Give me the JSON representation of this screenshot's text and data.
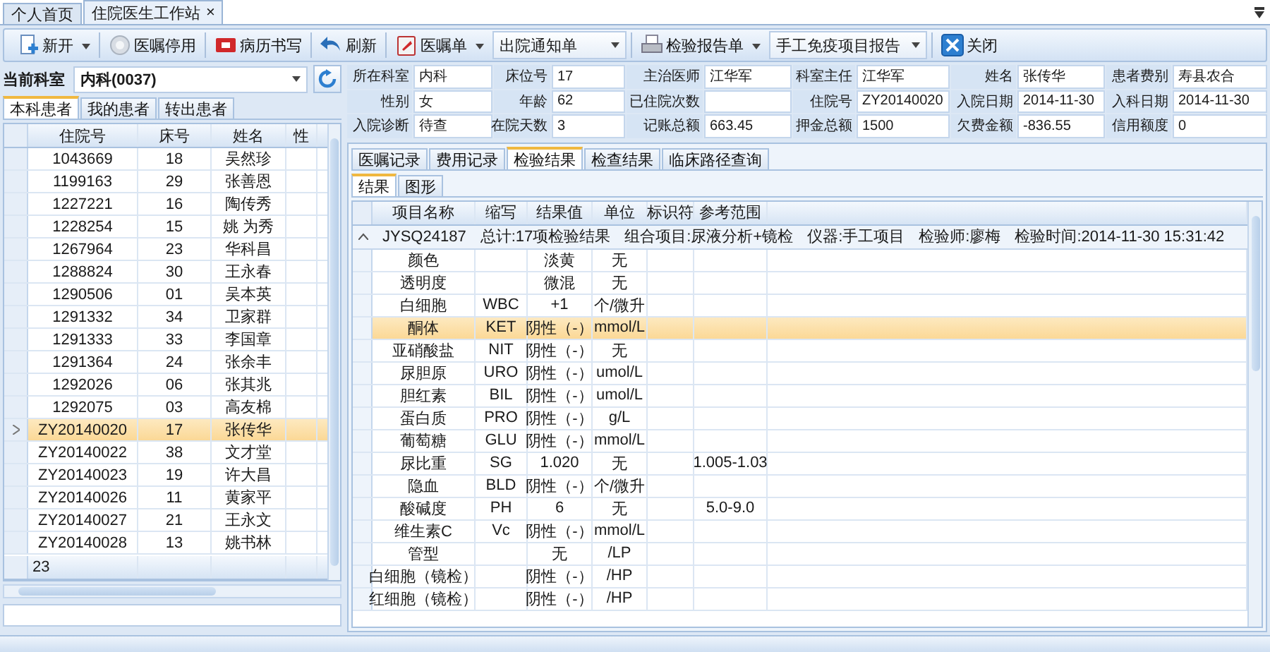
{
  "doc_tabs": [
    {
      "label": "个人首页",
      "selected": false
    },
    {
      "label": "住院医生工作站",
      "selected": true,
      "close": "×"
    }
  ],
  "toolbar": [
    {
      "kind": "button",
      "label": "新开",
      "dropdown": true
    },
    {
      "kind": "button",
      "label": "医嘱停用",
      "dropdown": false
    },
    {
      "kind": "button",
      "label": "病历书写",
      "dropdown": false
    },
    {
      "kind": "button",
      "label": "刷新",
      "dropdown": false
    },
    {
      "kind": "button",
      "label": "医嘱单",
      "dropdown": true
    },
    {
      "kind": "select",
      "value": "出院通知单"
    },
    {
      "kind": "button",
      "label": "检验报告单",
      "dropdown": true
    },
    {
      "kind": "select",
      "value": "手工免疫项目报告"
    },
    {
      "kind": "button",
      "label": "关闭",
      "dropdown": false
    }
  ],
  "department": {
    "label": "当前科室",
    "value": "内科(0037)"
  },
  "patient_tabs": [
    {
      "label": "本科患者",
      "selected": true
    },
    {
      "label": "我的患者",
      "selected": false
    },
    {
      "label": "转出患者",
      "selected": false
    }
  ],
  "patient_grid": {
    "columns": [
      "住院号",
      "床号",
      "姓名",
      "性"
    ],
    "rows": [
      {
        "id": "1043669",
        "bed": "18",
        "name": "吴然珍",
        "selected": false
      },
      {
        "id": "1199163",
        "bed": "29",
        "name": "张善恩",
        "selected": false
      },
      {
        "id": "1227221",
        "bed": "16",
        "name": "陶传秀",
        "selected": false
      },
      {
        "id": "1228254",
        "bed": "15",
        "name": "姚 为秀",
        "selected": false
      },
      {
        "id": "1267964",
        "bed": "23",
        "name": "华科昌",
        "selected": false
      },
      {
        "id": "1288824",
        "bed": "30",
        "name": "王永春",
        "selected": false
      },
      {
        "id": "1290506",
        "bed": "01",
        "name": "吴本英",
        "selected": false
      },
      {
        "id": "1291332",
        "bed": "34",
        "name": "卫家群",
        "selected": false
      },
      {
        "id": "1291333",
        "bed": "33",
        "name": "李国章",
        "selected": false
      },
      {
        "id": "1291364",
        "bed": "24",
        "name": "张余丰",
        "selected": false
      },
      {
        "id": "1292026",
        "bed": "06",
        "name": "张其兆",
        "selected": false
      },
      {
        "id": "1292075",
        "bed": "03",
        "name": "高友棉",
        "selected": false
      },
      {
        "id": "ZY20140020",
        "bed": "17",
        "name": "张传华",
        "selected": true
      },
      {
        "id": "ZY20140022",
        "bed": "38",
        "name": "文才堂",
        "selected": false
      },
      {
        "id": "ZY20140023",
        "bed": "19",
        "name": "许大昌",
        "selected": false
      },
      {
        "id": "ZY20140026",
        "bed": "11",
        "name": "黄家平",
        "selected": false
      },
      {
        "id": "ZY20140027",
        "bed": "21",
        "name": "王永文",
        "selected": false
      },
      {
        "id": "ZY20140028",
        "bed": "13",
        "name": "姚书林",
        "selected": false
      }
    ],
    "footer": "23"
  },
  "patient_info": [
    [
      {
        "label": "所在科室",
        "value": "内科"
      },
      {
        "label": "床位号",
        "value": "17"
      },
      {
        "label": "主治医师",
        "value": "江华军"
      },
      {
        "label": "科室主任",
        "value": "江华军"
      },
      {
        "label": "姓名",
        "value": "张传华"
      },
      {
        "label": "患者费别",
        "value": "寿县农合"
      }
    ],
    [
      {
        "label": "性别",
        "value": "女"
      },
      {
        "label": "年龄",
        "value": "62"
      },
      {
        "label": "已住院次数"
      },
      {
        "label": "住院号",
        "value": "ZY20140020"
      },
      {
        "label": "入院日期",
        "value": "2014-11-30"
      },
      {
        "label": "入科日期",
        "value": "2014-11-30"
      }
    ],
    [
      {
        "label": "入院诊断",
        "value": "待查"
      },
      {
        "label": "在院天数",
        "value": "3"
      },
      {
        "label": "记账总额",
        "value": "663.45"
      },
      {
        "label": "押金总额",
        "value": "1500"
      },
      {
        "label": "欠费金额",
        "value": "-836.55"
      },
      {
        "label": "信用额度",
        "value": "0"
      }
    ]
  ],
  "record_tabs": [
    {
      "label": "医嘱记录",
      "selected": false
    },
    {
      "label": "费用记录",
      "selected": false
    },
    {
      "label": "检验结果",
      "selected": true
    },
    {
      "label": "检查结果",
      "selected": false
    },
    {
      "label": "临床路径查询",
      "selected": false
    }
  ],
  "result_tabs": [
    {
      "label": "结果",
      "selected": true
    },
    {
      "label": "图形",
      "selected": false
    }
  ],
  "results": {
    "columns": [
      "项目名称",
      "缩写",
      "结果值",
      "单位",
      "标识符",
      "参考范围"
    ],
    "group": {
      "expanded": true,
      "id": "JYSQ24187",
      "summary": "总计:17项检验结果",
      "combo": "组合项目:尿液分析+镜检",
      "instrument": "仪器:手工项目",
      "tester": "检验师:廖梅",
      "time": "检验时间:2014-11-30 15:31:42"
    },
    "rows": [
      {
        "name": "颜色",
        "abbr": "",
        "value": "淡黄",
        "unit": "无",
        "range": "",
        "selected": false
      },
      {
        "name": "透明度",
        "abbr": "",
        "value": "微混",
        "unit": "无",
        "range": "",
        "selected": false
      },
      {
        "name": "白细胞",
        "abbr": "WBC",
        "value": "+1",
        "unit": "个/微升",
        "range": "",
        "selected": false
      },
      {
        "name": "酮体",
        "abbr": "KET",
        "value": "阴性（-）",
        "unit": "mmol/L",
        "range": "",
        "selected": true
      },
      {
        "name": "亚硝酸盐",
        "abbr": "NIT",
        "value": "阴性（-）",
        "unit": "无",
        "range": "",
        "selected": false
      },
      {
        "name": "尿胆原",
        "abbr": "URO",
        "value": "阴性（-）",
        "unit": "umol/L",
        "range": "",
        "selected": false
      },
      {
        "name": "胆红素",
        "abbr": "BIL",
        "value": "阴性（-）",
        "unit": "umol/L",
        "range": "",
        "selected": false
      },
      {
        "name": "蛋白质",
        "abbr": "PRO",
        "value": "阴性（-）",
        "unit": "g/L",
        "range": "",
        "selected": false
      },
      {
        "name": "葡萄糖",
        "abbr": "GLU",
        "value": "阴性（-）",
        "unit": "mmol/L",
        "range": "",
        "selected": false
      },
      {
        "name": "尿比重",
        "abbr": "SG",
        "value": "1.020",
        "unit": "无",
        "range": "1.005-1.03",
        "selected": false
      },
      {
        "name": "隐血",
        "abbr": "BLD",
        "value": "阴性（-）",
        "unit": "个/微升",
        "range": "",
        "selected": false
      },
      {
        "name": "酸碱度",
        "abbr": "PH",
        "value": "6",
        "unit": "无",
        "range": "5.0-9.0",
        "selected": false
      },
      {
        "name": "维生素C",
        "abbr": "Vc",
        "value": "阴性（-）",
        "unit": "mmol/L",
        "range": "",
        "selected": false
      },
      {
        "name": "管型",
        "abbr": "",
        "value": "无",
        "unit": "/LP",
        "range": "",
        "selected": false
      },
      {
        "name": "白细胞（镜检）",
        "abbr": "",
        "value": "阴性（-）",
        "unit": "/HP",
        "range": "",
        "selected": false
      },
      {
        "name": "红细胞（镜检）",
        "abbr": "",
        "value": "阴性（-）",
        "unit": "/HP",
        "range": "",
        "selected": false
      }
    ]
  }
}
